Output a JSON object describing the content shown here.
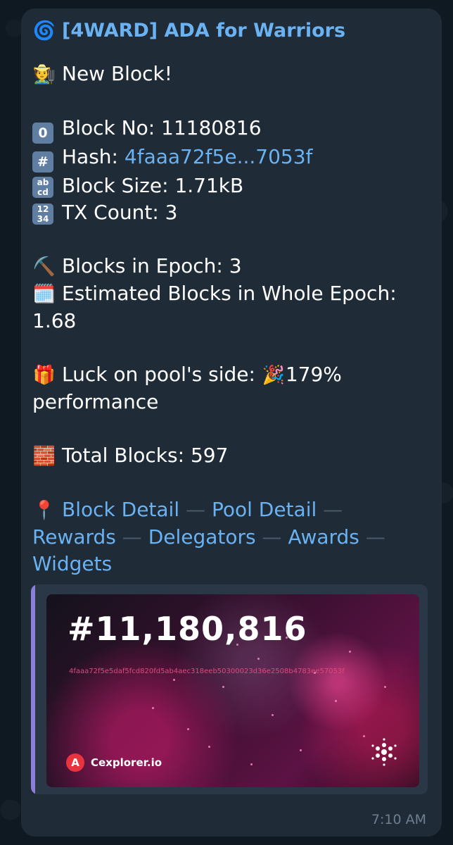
{
  "channel": {
    "icon": "cyclone-icon",
    "name": "[4WARD] ADA for Warriors"
  },
  "message": {
    "title_icon": "farmer-icon",
    "title": "New Block!",
    "block_no_icon": "keycap-zero-icon",
    "block_no": "Block No: 11180816",
    "hash_icon": "keycap-hash-icon",
    "hash_label": "Hash: ",
    "hash_value": "4faaa72f5e...7053f",
    "size_icon": "abcd-icon",
    "block_size": "Block Size: 1.71kB",
    "tx_icon": "numbers-icon",
    "tx_count": "TX Count: 3",
    "epoch_icon": "pick-icon",
    "blocks_in_epoch": "Blocks in Epoch: 3",
    "calendar_icon": "calendar-icon",
    "estimated_line1": "Estimated Blocks in Whole Epoch:",
    "estimated_line2": "1.68",
    "luck_icon": "gift-icon",
    "luck_text": "Luck on pool's side: ",
    "party_icon": "party-popper-icon",
    "luck_value": "179%",
    "luck_line2": "performance",
    "total_icon": "bricks-icon",
    "total_blocks": "Total Blocks: 597",
    "links_icon": "pin-icon",
    "links": {
      "block_detail": "Block Detail",
      "pool_detail": "Pool Detail",
      "rewards": "Rewards",
      "delegators": "Delegators",
      "awards": "Awards",
      "widgets": "Widgets"
    },
    "separator": "—"
  },
  "preview": {
    "block_number": "#11,180,816",
    "hash_full": "4faaa72f5e5daf5fcd820fd5ab4aec318eeb50300023d36e2508b4783ee57053f",
    "brand": "Cexplorer.io",
    "brand_icon": "cexplorer-logo-icon",
    "chain_icon": "cardano-logo-icon"
  },
  "timestamp": "7:10 AM",
  "colors": {
    "link": "#6ab2f2",
    "bubble": "#1f2b37",
    "background": "#0f1922",
    "accent_bar": "#8b7fdb"
  }
}
